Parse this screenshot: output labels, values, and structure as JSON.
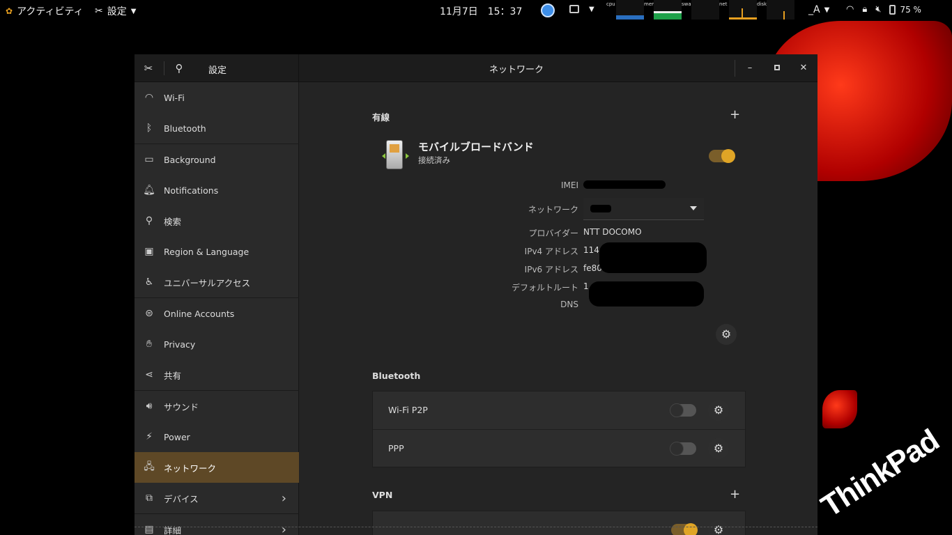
{
  "topbar": {
    "activities": "アクティビティ",
    "app_menu": "設定",
    "clock": "11月7日　15：37",
    "monitors": [
      "cpu",
      "mem",
      "swap",
      "net",
      "disk"
    ],
    "ime": "_A",
    "battery": "75 %"
  },
  "window": {
    "sidebar_title": "設定",
    "title": "ネットワーク"
  },
  "sidebar": {
    "items": [
      {
        "label": "Wi-Fi",
        "icon": "wifi-icon"
      },
      {
        "label": "Bluetooth",
        "icon": "bluetooth-icon"
      },
      {
        "label": "Background",
        "icon": "background-icon"
      },
      {
        "label": "Notifications",
        "icon": "bell-icon"
      },
      {
        "label": "検索",
        "icon": "search-icon"
      },
      {
        "label": "Region & Language",
        "icon": "camera-icon"
      },
      {
        "label": "ユニバーサルアクセス",
        "icon": "accessibility-icon"
      },
      {
        "label": "Online Accounts",
        "icon": "online-accounts-icon"
      },
      {
        "label": "Privacy",
        "icon": "hand-icon"
      },
      {
        "label": "共有",
        "icon": "share-icon"
      },
      {
        "label": "サウンド",
        "icon": "speaker-icon"
      },
      {
        "label": "Power",
        "icon": "power-icon"
      },
      {
        "label": "ネットワーク",
        "icon": "network-icon"
      },
      {
        "label": "デバイス",
        "icon": "devices-icon"
      },
      {
        "label": "詳細",
        "icon": "details-icon"
      }
    ]
  },
  "wired": {
    "section_title": "有線",
    "device_name": "モバイルブロードバンド",
    "device_status": "接続済み",
    "enabled": true,
    "details": {
      "imei_label": "IMEI",
      "network_label": "ネットワーク",
      "provider_label": "プロバイダー",
      "provider_value": "NTT DOCOMO",
      "ipv4_label": "IPv4 アドレス",
      "ipv4_value": "114",
      "ipv6_label": "IPv6 アドレス",
      "ipv6_value": "fe80",
      "route_label": "デフォルトルート",
      "route_value": "1",
      "dns_label": "DNS"
    }
  },
  "bluetooth": {
    "section_title": "Bluetooth",
    "rows": [
      {
        "label": "Wi-Fi P2P",
        "enabled": false
      },
      {
        "label": "PPP",
        "enabled": false
      }
    ]
  },
  "vpn": {
    "section_title": "VPN"
  },
  "wallpaper": {
    "brand": "ThinkPad"
  }
}
